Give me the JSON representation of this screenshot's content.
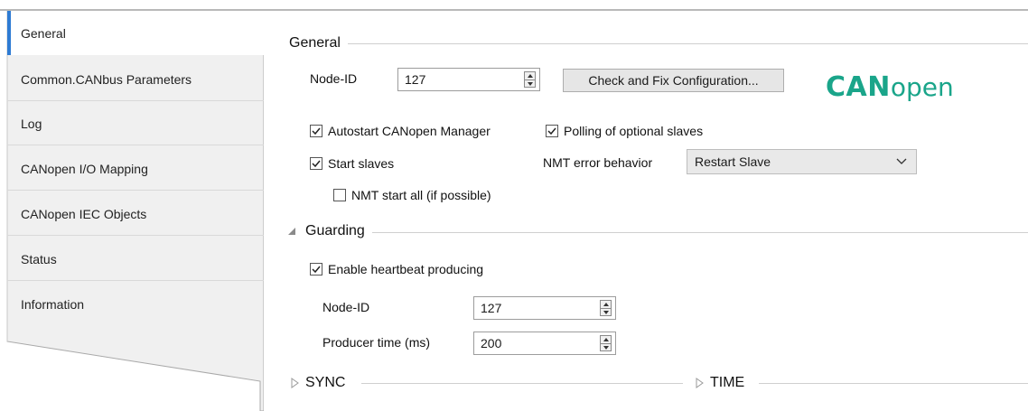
{
  "sidebar": {
    "items": [
      {
        "label": "General",
        "active": true
      },
      {
        "label": "Common.CANbus Parameters",
        "active": false
      },
      {
        "label": "Log",
        "active": false
      },
      {
        "label": "CANopen I/O Mapping",
        "active": false
      },
      {
        "label": "CANopen IEC Objects",
        "active": false
      },
      {
        "label": "Status",
        "active": false
      },
      {
        "label": "Information",
        "active": false
      }
    ]
  },
  "general": {
    "title": "General",
    "node_id_label": "Node-ID",
    "node_id_value": "127",
    "check_button": "Check and Fix Configuration...",
    "logo_bold": "CAN",
    "logo_light": "open",
    "autostart_label": "Autostart CANopen Manager",
    "autostart_checked": true,
    "polling_label": "Polling of optional slaves",
    "polling_checked": true,
    "start_slaves_label": "Start slaves",
    "start_slaves_checked": true,
    "nmt_error_label": "NMT error behavior",
    "nmt_error_value": "Restart Slave",
    "nmt_start_all_label": "NMT start all (if possible)",
    "nmt_start_all_checked": false
  },
  "guarding": {
    "title": "Guarding",
    "heartbeat_label": "Enable heartbeat producing",
    "heartbeat_checked": true,
    "node_id_label": "Node-ID",
    "node_id_value": "127",
    "producer_time_label": "Producer time (ms)",
    "producer_time_value": "200"
  },
  "sync": {
    "title": "SYNC"
  },
  "time": {
    "title": "TIME"
  },
  "colors": {
    "accent": "#2e7bd3",
    "logo": "#1aa58a",
    "sidebar_bg": "#f0f0f0"
  }
}
